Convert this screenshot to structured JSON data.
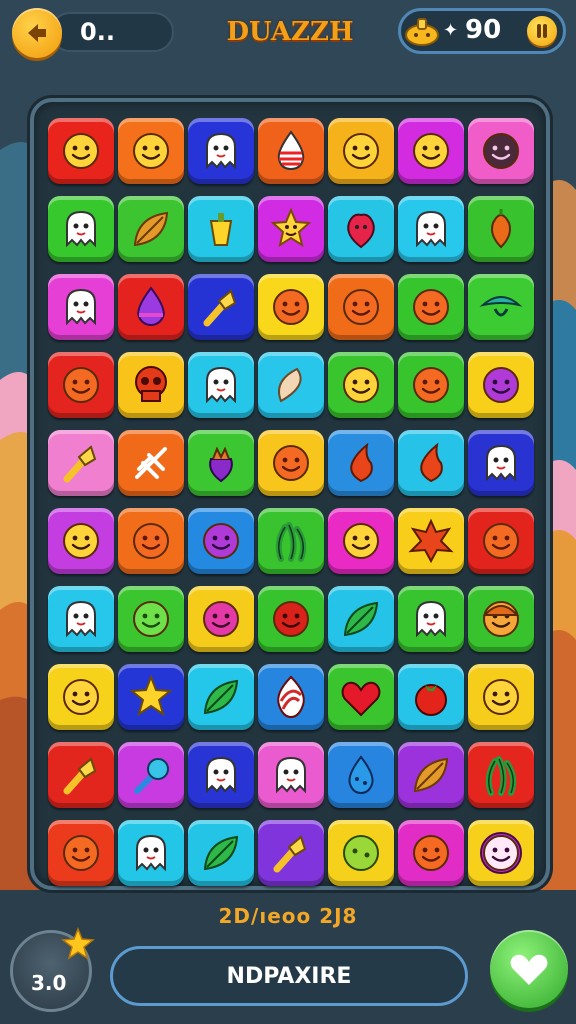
{
  "header": {
    "score": "0..",
    "logo": "DUAZZH",
    "coins": "90",
    "back_icon": "back-arrow-icon",
    "coin_icon": "lamp-gem-icon",
    "pause_icon": "pause-icon"
  },
  "board": {
    "rows": [
      [
        {
          "c": "#e8241c",
          "i": "smile"
        },
        {
          "c": "#f5701a",
          "i": "smile"
        },
        {
          "c": "#2734d8",
          "i": "ghost"
        },
        {
          "c": "#f0621a",
          "i": "drop"
        },
        {
          "c": "#f6b21b",
          "i": "smile"
        },
        {
          "c": "#d32be0",
          "i": "smile"
        },
        {
          "c": "#f05cc8",
          "i": "dark-face"
        }
      ],
      [
        {
          "c": "#37c82e",
          "i": "ghost"
        },
        {
          "c": "#3cc431",
          "i": "leaf"
        },
        {
          "c": "#24c7e6",
          "i": "pepper"
        },
        {
          "c": "#d22be4",
          "i": "star-face"
        },
        {
          "c": "#26c5e6",
          "i": "berry"
        },
        {
          "c": "#28c7ec",
          "i": "ghost"
        },
        {
          "c": "#38c22d",
          "i": "carrot"
        }
      ],
      [
        {
          "c": "#e63fd6",
          "i": "ghost"
        },
        {
          "c": "#e5231e",
          "i": "drop-purple"
        },
        {
          "c": "#2533d5",
          "i": "torch"
        },
        {
          "c": "#f9d71a",
          "i": "orange-face"
        },
        {
          "c": "#f06c19",
          "i": "orange-face"
        },
        {
          "c": "#37c52e",
          "i": "orange-face"
        },
        {
          "c": "#3dcb33",
          "i": "bowl"
        }
      ],
      [
        {
          "c": "#e4241e",
          "i": "orange-face"
        },
        {
          "c": "#f8c41a",
          "i": "skull"
        },
        {
          "c": "#26c6e8",
          "i": "ghost"
        },
        {
          "c": "#27c6ea",
          "i": "seed"
        },
        {
          "c": "#38c52e",
          "i": "smile"
        },
        {
          "c": "#37c42d",
          "i": "orange-face"
        },
        {
          "c": "#f8d01a",
          "i": "purple-face"
        }
      ],
      [
        {
          "c": "#f07fd0",
          "i": "torch"
        },
        {
          "c": "#f06a1a",
          "i": "skeleton"
        },
        {
          "c": "#3cc732",
          "i": "purple-fruit"
        },
        {
          "c": "#f7c51b",
          "i": "orange-face"
        },
        {
          "c": "#2a8ee0",
          "i": "flame"
        },
        {
          "c": "#26c2e8",
          "i": "flame"
        },
        {
          "c": "#2833d2",
          "i": "ghost"
        }
      ],
      [
        {
          "c": "#c43de0",
          "i": "smile"
        },
        {
          "c": "#f26d19",
          "i": "orange-face"
        },
        {
          "c": "#2489e0",
          "i": "purple-face"
        },
        {
          "c": "#39c32e",
          "i": "seaweed"
        },
        {
          "c": "#e92ac4",
          "i": "smile"
        },
        {
          "c": "#f8ce1b",
          "i": "splat"
        },
        {
          "c": "#e3241d",
          "i": "orange-face"
        }
      ],
      [
        {
          "c": "#26c7ea",
          "i": "ghost"
        },
        {
          "c": "#3bc52f",
          "i": "green-face"
        },
        {
          "c": "#f6cc1a",
          "i": "pink-face"
        },
        {
          "c": "#36c32d",
          "i": "red-face"
        },
        {
          "c": "#24c3e7",
          "i": "leaf-green"
        },
        {
          "c": "#38c42e",
          "i": "ghost"
        },
        {
          "c": "#38c32e",
          "i": "hat-face"
        }
      ],
      [
        {
          "c": "#f6d21b",
          "i": "smile"
        },
        {
          "c": "#2437d6",
          "i": "star"
        },
        {
          "c": "#24c6e9",
          "i": "leaf-green"
        },
        {
          "c": "#2585df",
          "i": "swirl"
        },
        {
          "c": "#3ac52f",
          "i": "heart"
        },
        {
          "c": "#25c4e8",
          "i": "tomato"
        },
        {
          "c": "#f6cd1b",
          "i": "smile"
        }
      ],
      [
        {
          "c": "#e3261d",
          "i": "torch"
        },
        {
          "c": "#c73be0",
          "i": "lollipop"
        },
        {
          "c": "#2835d4",
          "i": "ghost"
        },
        {
          "c": "#e95bcf",
          "i": "ghost"
        },
        {
          "c": "#2785e0",
          "i": "blue-drop"
        },
        {
          "c": "#9c32dc",
          "i": "leaf"
        },
        {
          "c": "#e4261e",
          "i": "seaweed"
        }
      ],
      [
        {
          "c": "#ec3b1c",
          "i": "orange-face"
        },
        {
          "c": "#24c6e8",
          "i": "ghost"
        },
        {
          "c": "#24c4e6",
          "i": "leaf-green"
        },
        {
          "c": "#7f34dc",
          "i": "torch"
        },
        {
          "c": "#f6d11b",
          "i": "lime"
        },
        {
          "c": "#e22cc6",
          "i": "orange-face"
        },
        {
          "c": "#f6d01b",
          "i": "flower-face"
        }
      ]
    ]
  },
  "footer": {
    "status_text": "2D/ıeoo 2J8",
    "level_label": "3.0",
    "action_label": "NDPAXIRE",
    "star_icon": "star-icon",
    "heart_icon": "heart-icon"
  },
  "colors": {
    "background": "#2f4756",
    "accent_orange": "#f2a726",
    "accent_blue": "#5c9ad0",
    "accent_green": "#2faa2b"
  }
}
